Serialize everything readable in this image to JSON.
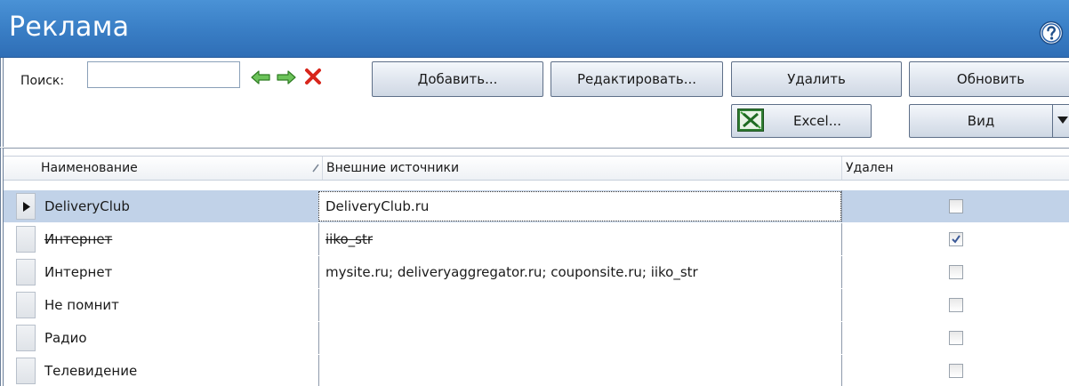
{
  "window": {
    "title": "Реклама",
    "help_icon": "help-icon"
  },
  "toolbar": {
    "search_label": "Поиск:",
    "search_value": "",
    "search_placeholder": "",
    "buttons": {
      "add": "Добавить...",
      "edit": "Редактировать...",
      "delete": "Удалить",
      "refresh": "Обновить",
      "excel": "Excel...",
      "view": "Вид"
    },
    "icons": [
      "arrow-left-icon",
      "arrow-right-icon",
      "delete-x-icon",
      "excel-icon",
      "dropdown-arrow-icon"
    ]
  },
  "grid": {
    "columns": [
      "Наименование",
      "Внешние источники",
      "Удален"
    ],
    "rows": [
      {
        "name": "DeliveryClub",
        "sources": "DeliveryClub.ru",
        "deleted": false,
        "selected": true,
        "strike": false
      },
      {
        "name": "Интернет",
        "sources": "iiko_str",
        "deleted": true,
        "selected": false,
        "strike": true
      },
      {
        "name": "Интернет",
        "sources": "mysite.ru; deliveryaggregator.ru; couponsite.ru; iiko_str",
        "deleted": false,
        "selected": false,
        "strike": false
      },
      {
        "name": "Не помнит",
        "sources": "",
        "deleted": false,
        "selected": false,
        "strike": false
      },
      {
        "name": "Радио",
        "sources": "",
        "deleted": false,
        "selected": false,
        "strike": false
      },
      {
        "name": "Телевидение",
        "sources": "",
        "deleted": false,
        "selected": false,
        "strike": false
      }
    ]
  },
  "colors": {
    "titlebar": "#3a7fc6",
    "selected_row": "#c1d2e8",
    "arrow_green": "#3aa62e",
    "delete_red": "#d8261c"
  }
}
